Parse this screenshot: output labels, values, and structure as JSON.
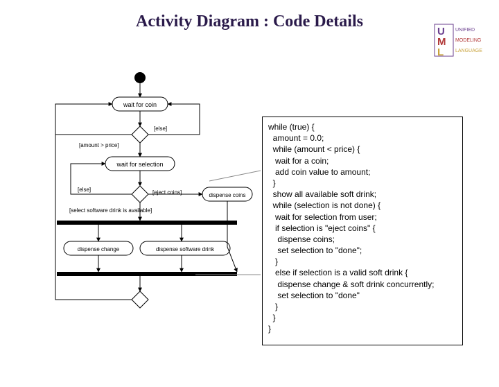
{
  "title": "Activity Diagram : Code Details",
  "logo": {
    "top": "UNIFIED",
    "mid": "MODELING",
    "bot": "LANGUAGE"
  },
  "diagram": {
    "waitCoin": "wait for coin",
    "guardElse1": "[else]",
    "guardAmount": "[amount > price]",
    "waitSel": "wait for selection",
    "guardElse2": "[else]",
    "guardEject": "[eject coins]",
    "guardAvail": "[select software drink is available]",
    "dispCoins": "dispense coins",
    "dispChange": "dispense change",
    "dispDrink": "dispense software drink"
  },
  "code": "while (true) {\n  amount = 0.0;\n  while (amount < price) {\n   wait for a coin;\n   add coin value to amount;\n  }\n  show all available soft drink;\n  while (selection is not done) {\n   wait for selection from user;\n   if selection is \"eject coins\" {\n    dispense coins;\n    set selection to \"done\";\n   }\n   else if selection is a valid soft drink {\n    dispense change & soft drink concurrently;\n    set selection to \"done\"\n   }\n  }\n}"
}
